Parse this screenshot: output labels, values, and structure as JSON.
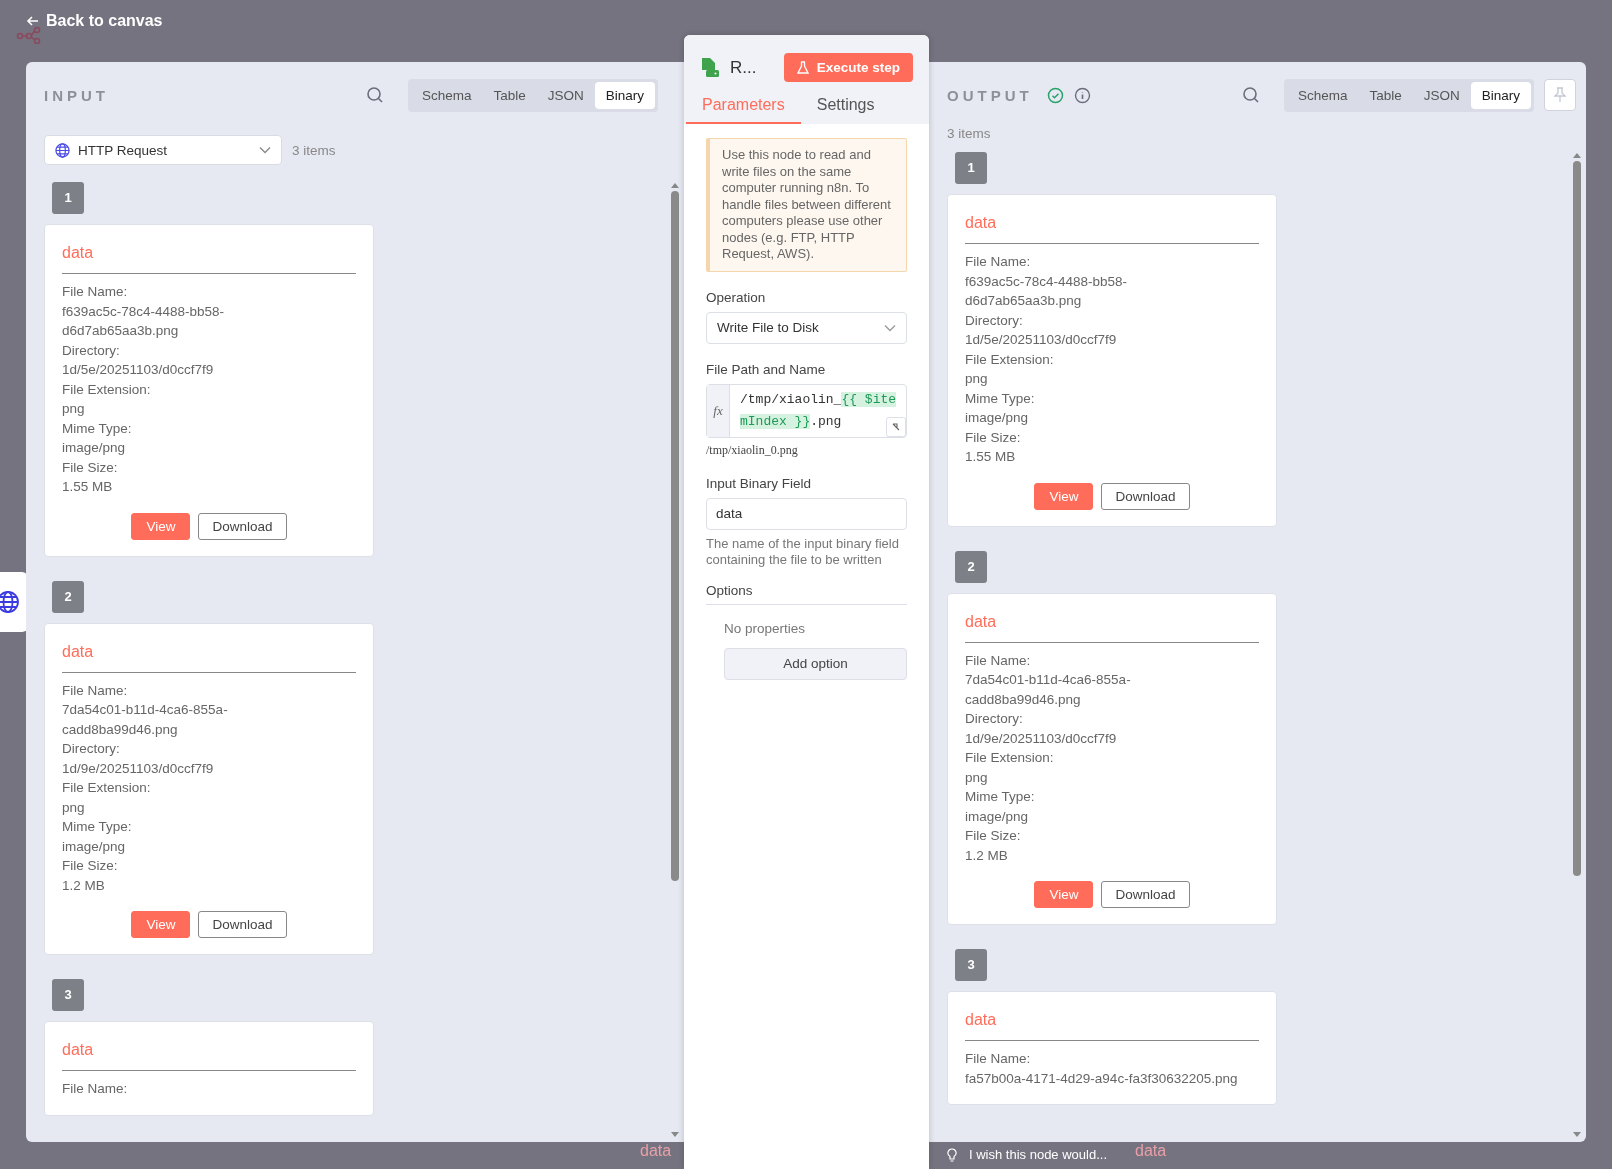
{
  "top_bar": {
    "back_link": "Back to canvas"
  },
  "input": {
    "title": "INPUT",
    "tabs": [
      {
        "label": "Schema",
        "selected": false
      },
      {
        "label": "Table",
        "selected": false
      },
      {
        "label": "JSON",
        "selected": false
      },
      {
        "label": "Binary",
        "selected": true
      }
    ],
    "node_select": {
      "value": "HTTP Request"
    },
    "item_count": "3 items",
    "items": [
      {
        "number": "1",
        "name": "data",
        "fields": [
          {
            "label": "File Name:",
            "value": "f639ac5c-78c4-4488-bb58-d6d7ab65aa3b.png"
          },
          {
            "label": "Directory:",
            "value": "1d/5e/20251103/d0ccf7f9"
          },
          {
            "label": "File Extension:",
            "value": "png"
          },
          {
            "label": "Mime Type:",
            "value": "image/png"
          },
          {
            "label": "File Size:",
            "value": "1.55 MB"
          }
        ],
        "buttons": [
          "View",
          "Download"
        ]
      },
      {
        "number": "2",
        "name": "data",
        "fields": [
          {
            "label": "File Name:",
            "value": "7da54c01-b11d-4ca6-855a-cadd8ba99d46.png"
          },
          {
            "label": "Directory:",
            "value": "1d/9e/20251103/d0ccf7f9"
          },
          {
            "label": "File Extension:",
            "value": "png"
          },
          {
            "label": "Mime Type:",
            "value": "image/png"
          },
          {
            "label": "File Size:",
            "value": "1.2 MB"
          }
        ],
        "buttons": [
          "View",
          "Download"
        ]
      },
      {
        "number": "3",
        "name": "data",
        "fields": [
          {
            "label": "File Name:"
          }
        ]
      }
    ]
  },
  "node_panel": {
    "node_name": "R...",
    "execute_button": "Execute step",
    "tabs": [
      {
        "label": "Parameters",
        "selected": true
      },
      {
        "label": "Settings",
        "selected": false
      }
    ],
    "notice": "Use this node to read and write files on the same computer running n8n. To handle files between different computers please use other nodes (e.g. FTP, HTTP Request, AWS).",
    "operation": {
      "label": "Operation",
      "value": "Write File to Disk"
    },
    "file_path": {
      "label": "File Path and Name",
      "mode_label": "fx",
      "parts": [
        {
          "kind": "text",
          "text": "/tmp/xiaolin_"
        },
        {
          "kind": "expression",
          "text": "{{ $itemIndex }}"
        },
        {
          "kind": "text",
          "text": ".png"
        }
      ],
      "preview": "/tmp/xiaolin_0.png"
    },
    "binary_field": {
      "label": "Input Binary Field",
      "value": "data",
      "hint": "The name of the input binary field containing the file to be written"
    },
    "options": {
      "label": "Options",
      "empty_text": "No properties",
      "add_button": "Add option"
    }
  },
  "output": {
    "title": "OUTPUT",
    "tabs": [
      {
        "label": "Schema",
        "selected": false
      },
      {
        "label": "Table",
        "selected": false
      },
      {
        "label": "JSON",
        "selected": false
      },
      {
        "label": "Binary",
        "selected": true
      }
    ],
    "item_count": "3 items",
    "items": [
      {
        "number": "1",
        "name": "data",
        "fields": [
          {
            "label": "File Name:",
            "value": "f639ac5c-78c4-4488-bb58-d6d7ab65aa3b.png"
          },
          {
            "label": "Directory:",
            "value": "1d/5e/20251103/d0ccf7f9"
          },
          {
            "label": "File Extension:",
            "value": "png"
          },
          {
            "label": "Mime Type:",
            "value": "image/png"
          },
          {
            "label": "File Size:",
            "value": "1.55 MB"
          }
        ],
        "buttons": [
          "View",
          "Download"
        ]
      },
      {
        "number": "2",
        "name": "data",
        "fields": [
          {
            "label": "File Name:",
            "value": "7da54c01-b11d-4ca6-855a-cadd8ba99d46.png"
          },
          {
            "label": "Directory:",
            "value": "1d/9e/20251103/d0ccf7f9"
          },
          {
            "label": "File Extension:",
            "value": "png"
          },
          {
            "label": "Mime Type:",
            "value": "image/png"
          },
          {
            "label": "File Size:",
            "value": "1.2 MB"
          }
        ],
        "buttons": [
          "View",
          "Download"
        ]
      },
      {
        "number": "3",
        "name": "data",
        "fields": [
          {
            "label": "File Name:",
            "value": "fa57b00a-4171-4d29-a94c-fa3f30632205.png"
          }
        ]
      }
    ]
  },
  "background": {
    "data_labels": [
      "data",
      "data"
    ],
    "feedback": "I wish this node would..."
  }
}
